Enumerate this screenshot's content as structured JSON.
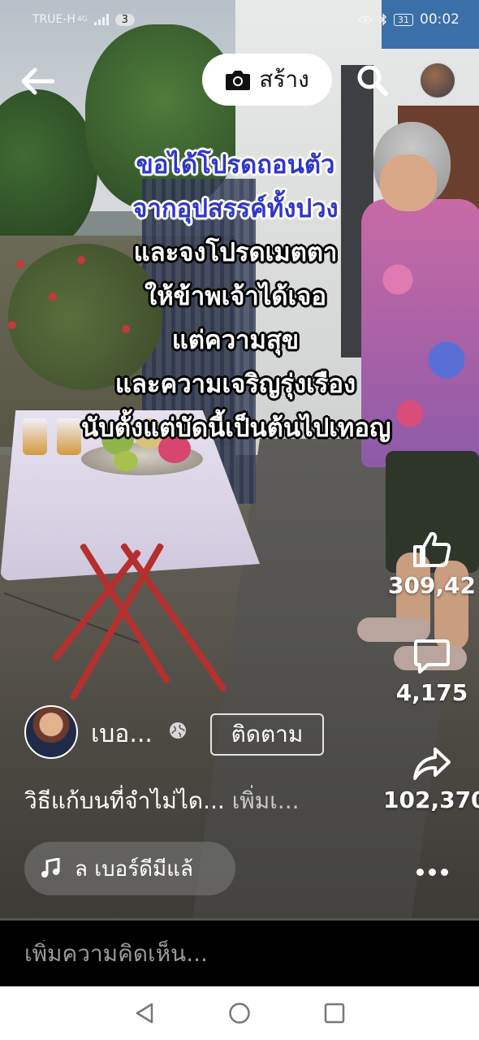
{
  "status_bar": {
    "carrier": "TRUE-H",
    "network": "4G",
    "notification_count": "3",
    "battery": "31",
    "time": "00:02"
  },
  "header": {
    "create_label": "สร้าง",
    "back_icon": "arrow-left-icon",
    "camera_icon": "camera-icon",
    "search_icon": "search-icon"
  },
  "caption_lines": [
    {
      "text": "ขอได้โปรดถอนตัว",
      "color": "#2f36c8"
    },
    {
      "text": "จากอุปสรรค์ทั้งปวง",
      "color": "#2f36c8"
    },
    {
      "text": "และจงโปรดเมตตา",
      "color": "#ffffff"
    },
    {
      "text": "ให้ข้าพเจ้าได้เจอ",
      "color": "#ffffff"
    },
    {
      "text": "แต่ความสุข",
      "color": "#ffffff"
    },
    {
      "text": "และความเจริญรุ่งเรือง",
      "color": "#ffffff"
    },
    {
      "text": "นับตั้งแต่บัดนี้เป็นต้นไปเทอญ",
      "color": "#ffffff"
    }
  ],
  "actions": {
    "likes": "309,42",
    "comments": "4,175",
    "shares": "102,370"
  },
  "post": {
    "author_name": "เบอ...",
    "follow_label": "ติดตาม",
    "description": "วิธีแก้บนที่จำไม่ได...",
    "see_more": "เพิ่มเ...",
    "music_text": "ล เบอร์ดีมีแล้"
  },
  "comment_bar": {
    "placeholder": "เพิ่มความคิดเห็น..."
  },
  "colors": {
    "caption_blue": "#2f36c8",
    "nav_bar_bg": "#ffffff",
    "comment_bar_bg": "#000000"
  }
}
